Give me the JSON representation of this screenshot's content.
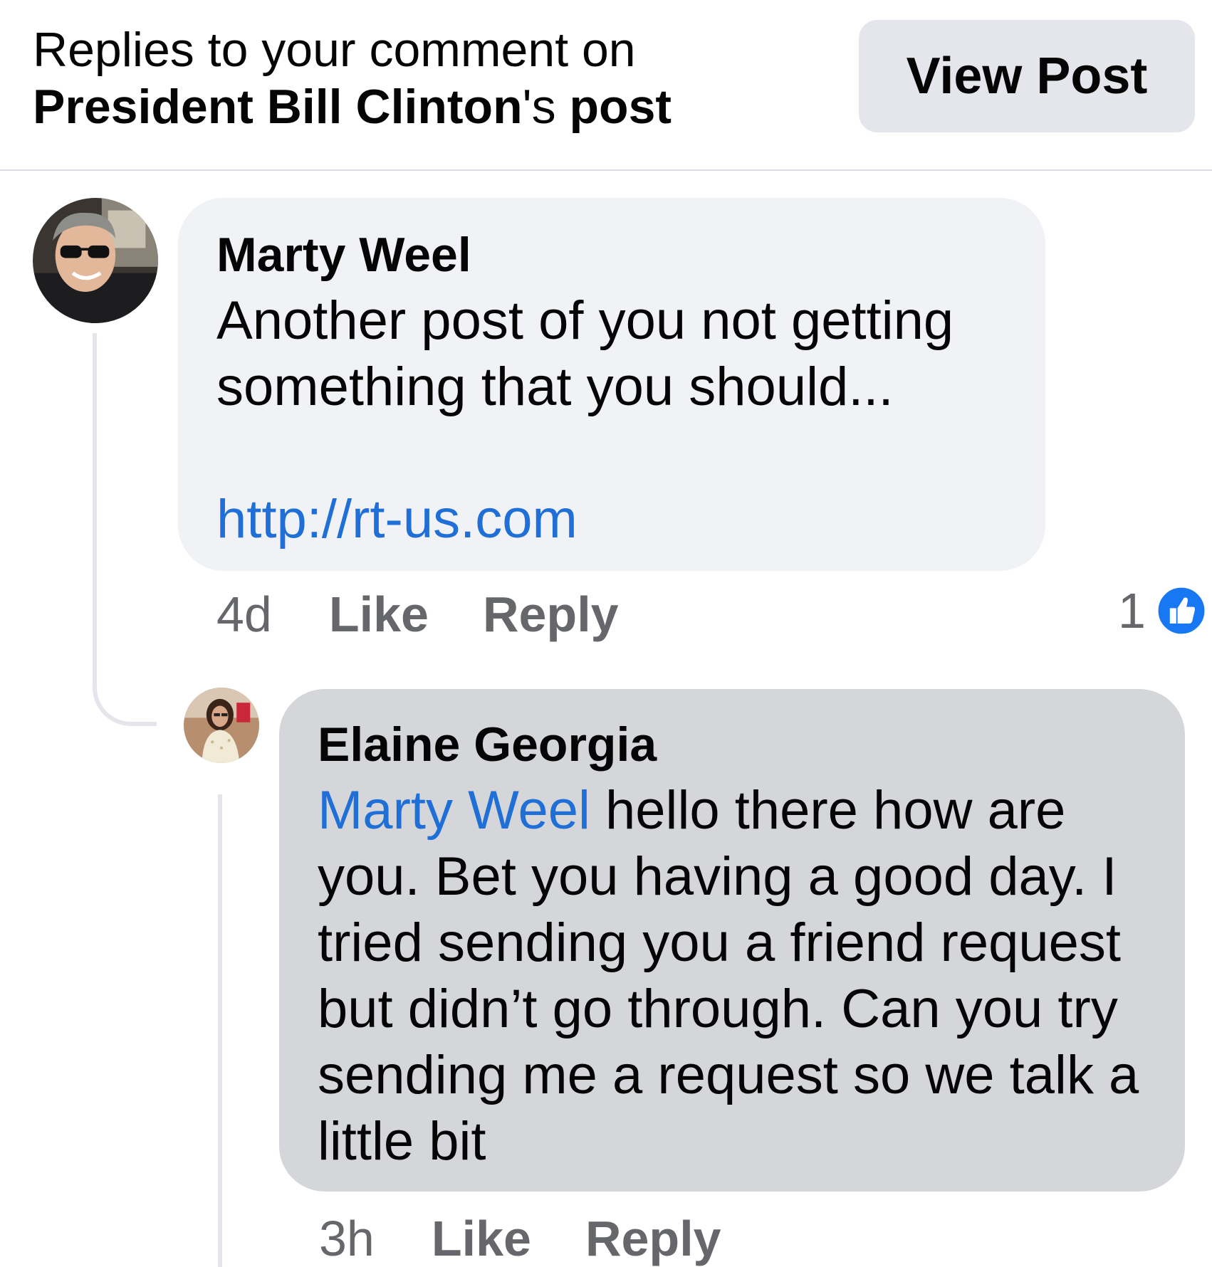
{
  "header": {
    "line1": "Replies to your comment on",
    "name_bold": "President Bill Clinton",
    "possessive": "'s",
    "post_bold": "post",
    "view_post_label": "View Post"
  },
  "comments": [
    {
      "author": "Marty Weel",
      "text_line": "Another post of you not getting something that you should...",
      "link": "http://rt-us.com",
      "time": "4d",
      "like_label": "Like",
      "reply_label": "Reply",
      "reaction_count": "1",
      "reaction_icon": "thumbs-up-icon",
      "reaction_color": "#1877f2"
    },
    {
      "author": "Elaine Georgia",
      "mention": "Marty Weel",
      "text": " hello there how are you. Bet you having a good day. I tried sending you a friend request but didn’t go through. Can you try sending me a request so we talk a little bit",
      "time": "3h",
      "like_label": "Like",
      "reply_label": "Reply"
    }
  ],
  "colors": {
    "link": "#1f6fd6",
    "bubble_primary": "#f0f2f5",
    "bubble_reply": "#d4d6da",
    "meta_text": "#65676b"
  }
}
